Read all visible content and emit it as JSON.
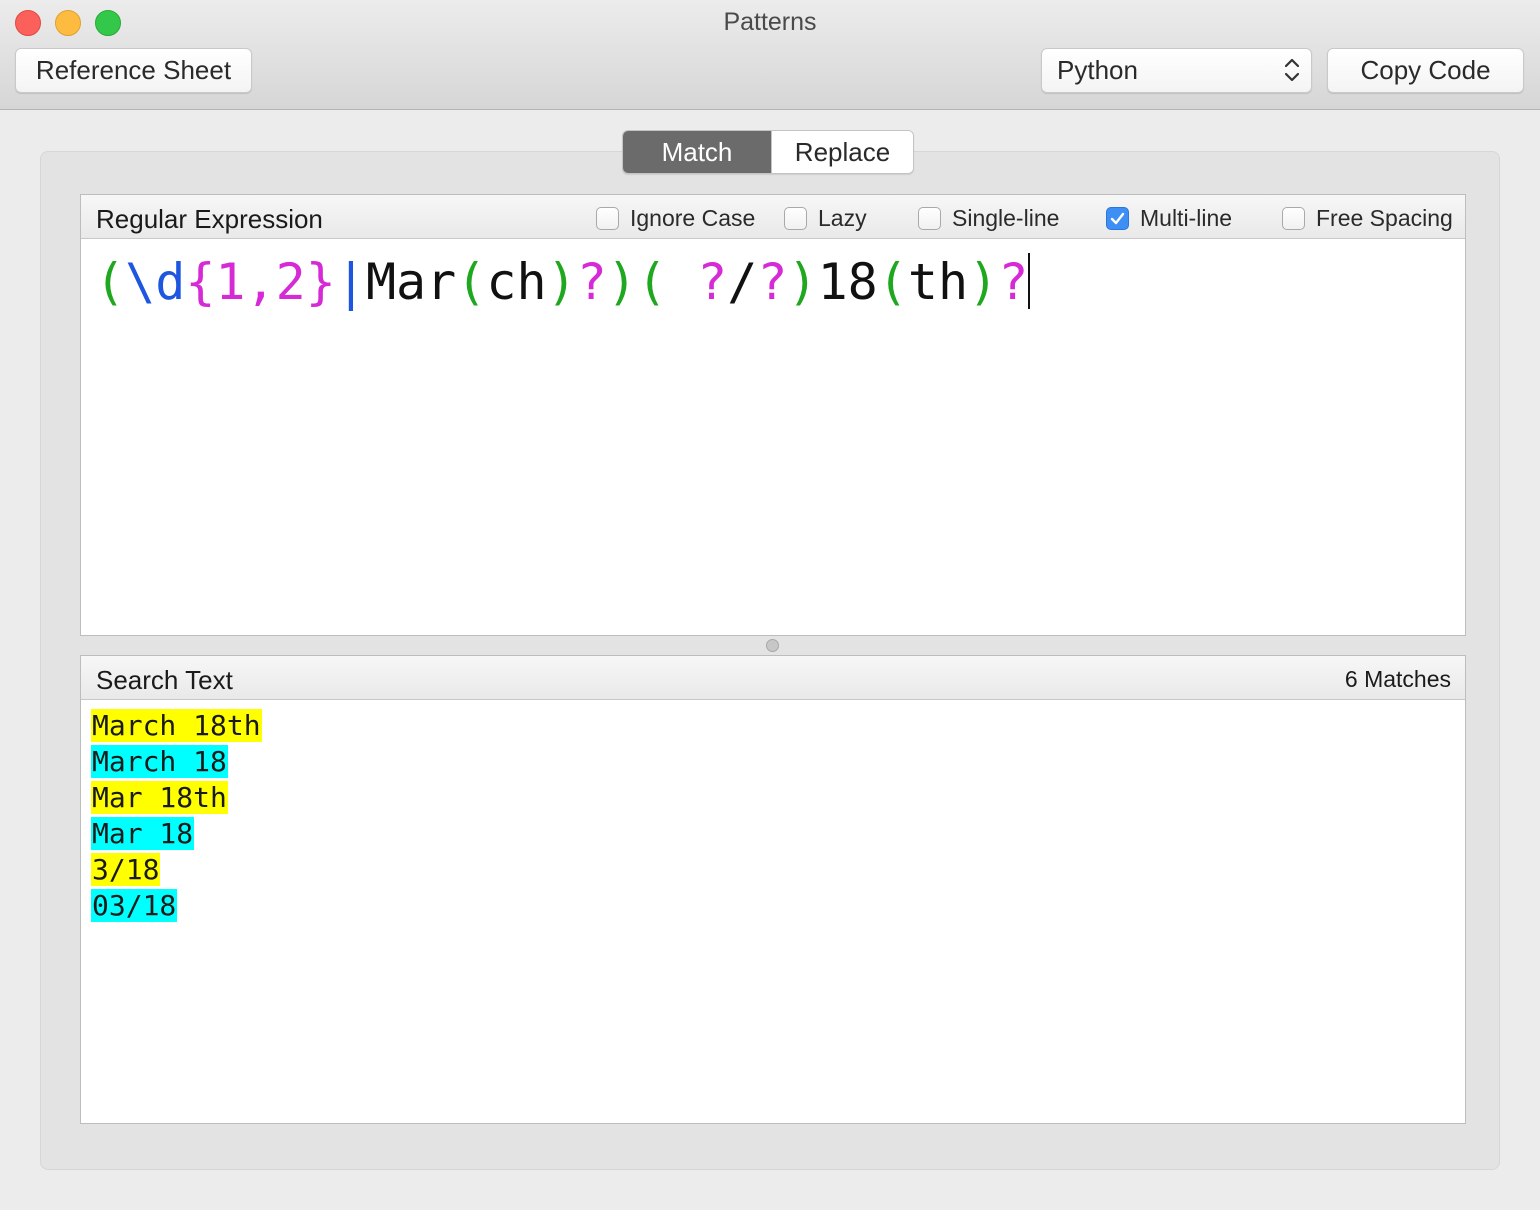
{
  "window": {
    "title": "Patterns"
  },
  "toolbar": {
    "reference_label": "Reference Sheet",
    "language_value": "Python",
    "copy_label": "Copy Code"
  },
  "mode_tabs": [
    {
      "label": "Match",
      "selected": true
    },
    {
      "label": "Replace",
      "selected": false
    }
  ],
  "regex_panel": {
    "title": "Regular Expression",
    "options": [
      {
        "label": "Ignore Case",
        "checked": false
      },
      {
        "label": "Lazy",
        "checked": false
      },
      {
        "label": "Single-line",
        "checked": false
      },
      {
        "label": "Multi-line",
        "checked": true
      },
      {
        "label": "Free Spacing",
        "checked": false
      }
    ],
    "expression": "(\\d{1,2}|Mar(ch)?)( ?/?)18(th)?",
    "tokens": [
      {
        "text": "(",
        "color": "#1fa81f"
      },
      {
        "text": "\\d",
        "color": "#1f56e0"
      },
      {
        "text": "{1,2}",
        "color": "#d52ad5"
      },
      {
        "text": "|",
        "color": "#1f56e0"
      },
      {
        "text": "Mar",
        "color": "#111111"
      },
      {
        "text": "(",
        "color": "#1fa81f"
      },
      {
        "text": "ch",
        "color": "#111111"
      },
      {
        "text": ")",
        "color": "#1fa81f"
      },
      {
        "text": "?",
        "color": "#d52ad5"
      },
      {
        "text": ")",
        "color": "#1fa81f"
      },
      {
        "text": "(",
        "color": "#1fa81f"
      },
      {
        "text": " ",
        "color": "#111111"
      },
      {
        "text": "?",
        "color": "#d52ad5"
      },
      {
        "text": "/",
        "color": "#111111"
      },
      {
        "text": "?",
        "color": "#d52ad5"
      },
      {
        "text": ")",
        "color": "#1fa81f"
      },
      {
        "text": "18",
        "color": "#111111"
      },
      {
        "text": "(",
        "color": "#1fa81f"
      },
      {
        "text": "th",
        "color": "#111111"
      },
      {
        "text": ")",
        "color": "#1fa81f"
      },
      {
        "text": "?",
        "color": "#d52ad5"
      }
    ]
  },
  "search_panel": {
    "title": "Search Text",
    "match_count": "6 Matches",
    "lines": [
      {
        "text": "March 18th",
        "highlight": "yellow"
      },
      {
        "text": "March 18",
        "highlight": "cyan"
      },
      {
        "text": "Mar 18th",
        "highlight": "yellow"
      },
      {
        "text": "Mar 18",
        "highlight": "cyan"
      },
      {
        "text": "3/18",
        "highlight": "yellow"
      },
      {
        "text": "03/18",
        "highlight": "cyan"
      }
    ]
  },
  "colors": {
    "match_highlight_1": "#ffff00",
    "match_highlight_2": "#00ffff",
    "checkbox_accent": "#3d8ff5"
  }
}
